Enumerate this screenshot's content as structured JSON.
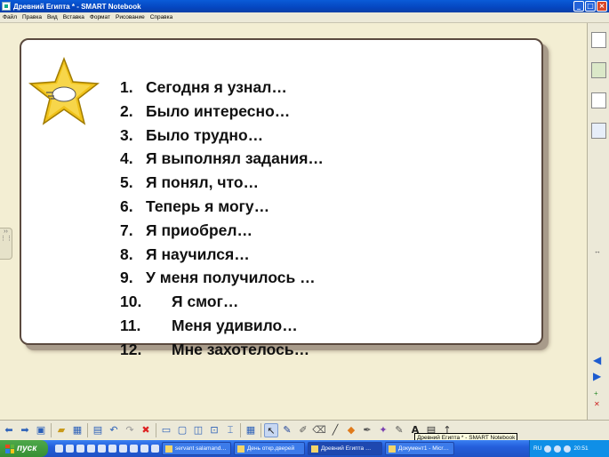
{
  "window": {
    "title": "Древний Египта * - SMART Notebook"
  },
  "menu": [
    "Файл",
    "Правка",
    "Вид",
    "Вставка",
    "Формат",
    "Рисование",
    "Справка"
  ],
  "list": [
    {
      "num": "1.",
      "text": "Сегодня я узнал…"
    },
    {
      "num": "2.",
      "text": "Было интересно…"
    },
    {
      "num": "3.",
      "text": "Было трудно…"
    },
    {
      "num": "4.",
      "text": "Я выполнял задания…"
    },
    {
      "num": "5.",
      "text": "Я понял, что…"
    },
    {
      "num": "6.",
      "text": "Теперь я могу…"
    },
    {
      "num": "7.",
      "text": "Я приобрел…"
    },
    {
      "num": "8.",
      "text": "Я научился…"
    },
    {
      "num": "9.",
      "text": "У меня получилось …"
    },
    {
      "num": "10.",
      "text": "Я смог…"
    },
    {
      "num": "11.",
      "text": "Меня удивило…"
    },
    {
      "num": "12.",
      "text": "Мне захотелось…"
    }
  ],
  "tooltip": "Древний Египта * - SMART Notebook",
  "toolbar_text": {
    "font": "A"
  },
  "taskbar": {
    "start": "пуск",
    "tasks": [
      {
        "label": "servant salamand…",
        "active": false
      },
      {
        "label": "День откр.дверей",
        "active": false
      },
      {
        "label": "Древний Египта …",
        "active": true
      },
      {
        "label": "Документ1 - Micr…",
        "active": false
      }
    ],
    "lang": "RU",
    "clock": "20:51"
  },
  "colors": {
    "star": "#f0c21a",
    "card_border": "#5b4a3f",
    "canvas_bg": "#f3eed3"
  }
}
